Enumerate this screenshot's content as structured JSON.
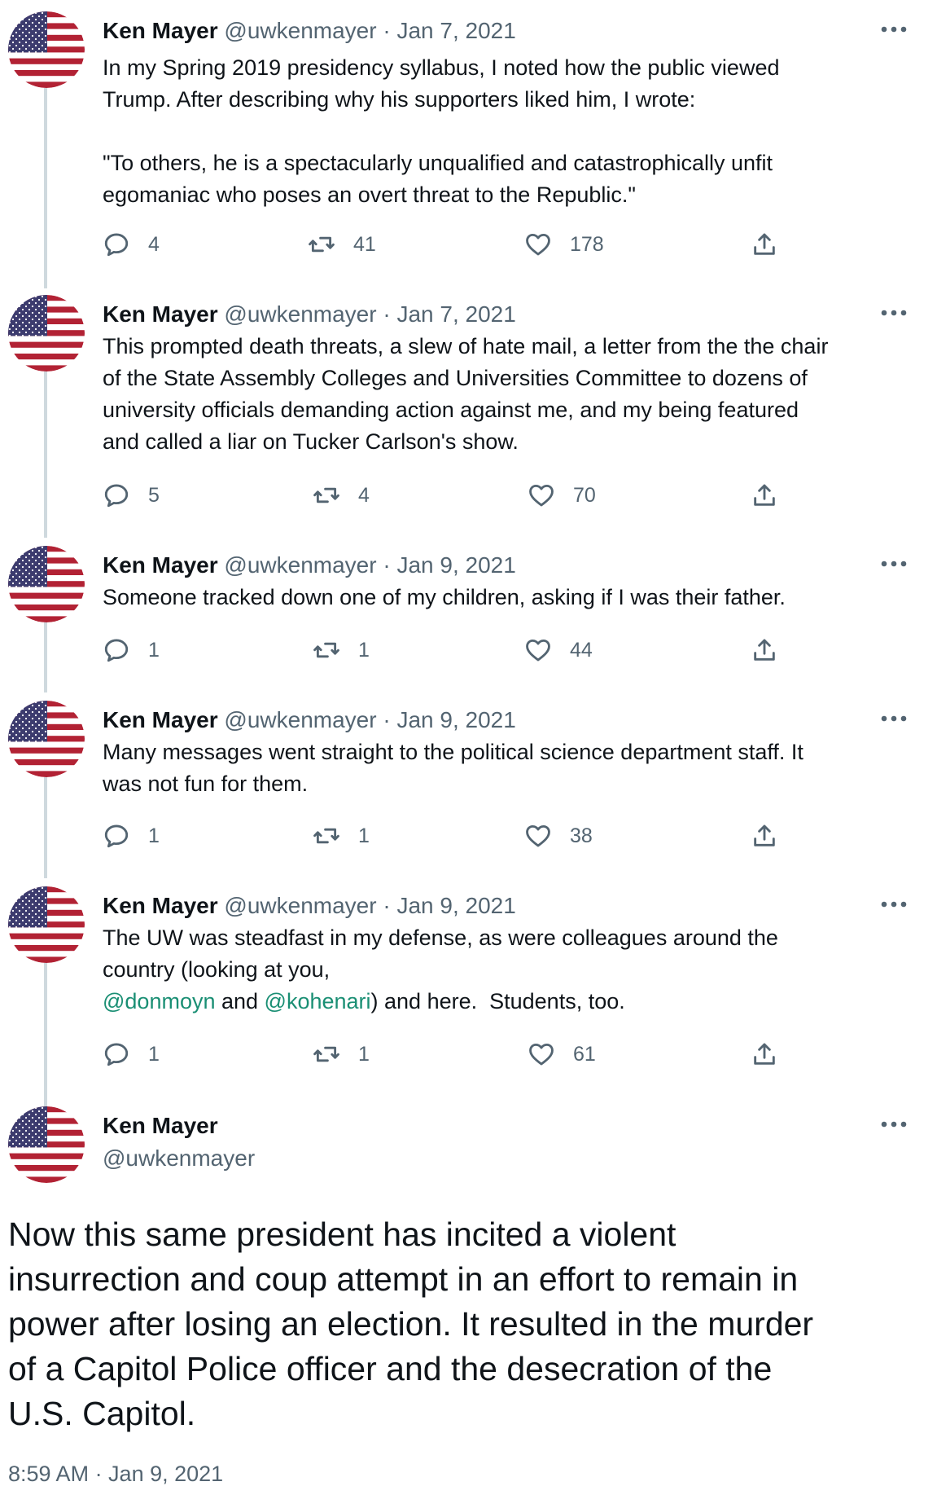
{
  "tweets": [
    {
      "name": "Ken Mayer",
      "handle": "@uwkenmayer",
      "sep": "·",
      "date": "Jan 7, 2021",
      "lines": [
        "In my Spring 2019 presidency syllabus, I noted how the public viewed",
        "Trump.  After describing why his supporters liked him, I wrote:",
        "",
        "\"To others, he is a spectacularly unqualified and catastrophically unfit",
        "egomaniac who poses an overt threat to the Republic.\""
      ],
      "replies": "4",
      "retweets": "41",
      "likes": "178"
    },
    {
      "name": "Ken Mayer",
      "handle": "@uwkenmayer",
      "sep": "·",
      "date": "Jan 7, 2021",
      "lines": [
        "This prompted death threats, a slew of hate mail, a letter from the the chair",
        "of the State Assembly Colleges and Universities Committee to dozens of",
        "university officials demanding action against me, and my being featured",
        "and called a liar on Tucker Carlson's show."
      ],
      "replies": "5",
      "retweets": "4",
      "likes": "70"
    },
    {
      "name": "Ken Mayer",
      "handle": "@uwkenmayer",
      "sep": "·",
      "date": "Jan 9, 2021",
      "lines": [
        "Someone tracked down one of my children, asking if I was their father."
      ],
      "replies": "1",
      "retweets": "1",
      "likes": "44"
    },
    {
      "name": "Ken Mayer",
      "handle": "@uwkenmayer",
      "sep": "·",
      "date": "Jan 9, 2021",
      "lines": [
        "Many messages went straight to the political science department staff.  It",
        "was not fun for them."
      ],
      "replies": "1",
      "retweets": "1",
      "likes": "38"
    },
    {
      "name": "Ken Mayer",
      "handle": "@uwkenmayer",
      "sep": "·",
      "date": "Jan 9, 2021",
      "lines": [
        "The UW was steadfast in my defense, as were colleagues around the",
        "country (looking at you,"
      ],
      "mention_line": {
        "mention1": "@donmoyn",
        "and": " and ",
        "mention2": "@kohenari",
        "rest": ") and here.  Students, too."
      },
      "replies": "1",
      "retweets": "1",
      "likes": "61"
    }
  ],
  "final": {
    "name": "Ken Mayer",
    "handle": "@uwkenmayer",
    "text": "Now this same president has incited a violent insurrection and coup attempt in an effort to remain in power after losing an election.  It resulted in the murder of a Capitol Police officer and the desecration of the U.S. Capitol.",
    "text_lines": [
      "Now this same president has incited a violent",
      "insurrection and coup attempt in an effort to remain in",
      "power after losing an election.  It resulted in the murder",
      "of a Capitol Police officer and the desecration of the",
      "U.S. Capitol."
    ],
    "timestamp": "8:59 AM · Jan 9, 2021"
  },
  "icons": {
    "reply": "reply-icon",
    "retweet": "retweet-icon",
    "like": "heart-icon",
    "share": "share-icon",
    "more": "more-options-icon"
  },
  "colors": {
    "text": "#0f1419",
    "muted": "#536471",
    "mention": "#1a8f74",
    "thread_line": "#cfd9de",
    "flag_red": "#b22234",
    "flag_blue": "#3c3b6e"
  }
}
